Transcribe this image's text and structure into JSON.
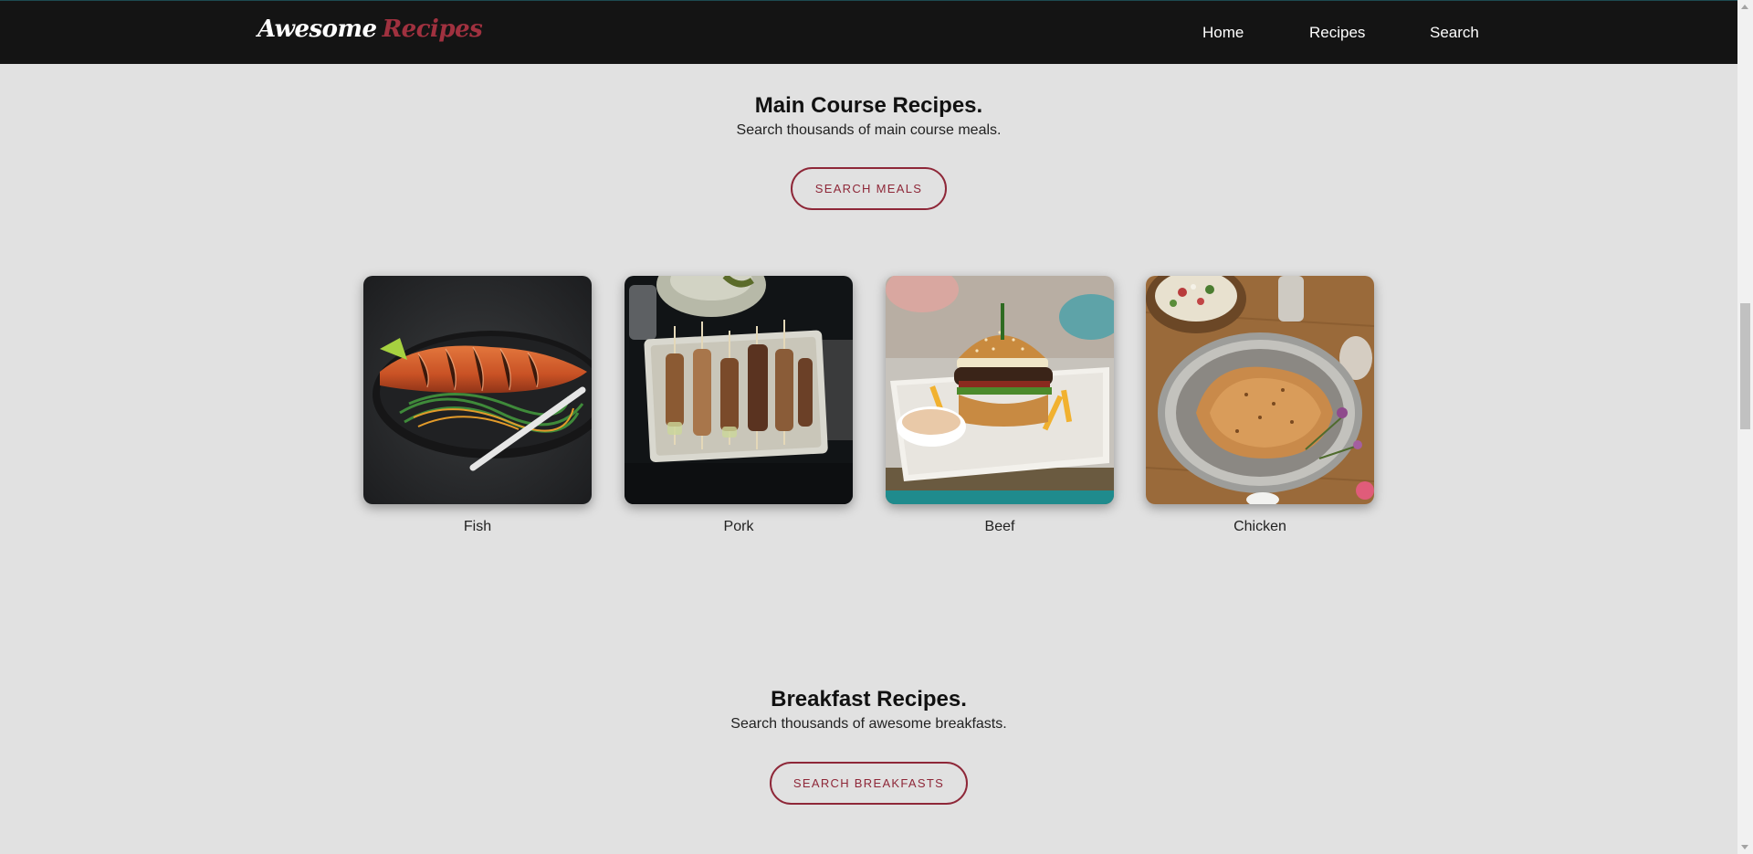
{
  "nav": {
    "brand_part1": "Awesome",
    "brand_part2": "Recipes",
    "links": [
      "Home",
      "Recipes",
      "Search"
    ]
  },
  "main_course": {
    "title": "Main Course Recipes.",
    "subtitle": "Search thousands of main course meals.",
    "button": "SEARCH MEALS",
    "cards": [
      {
        "label": "Fish",
        "icon": "salmon-plate-image"
      },
      {
        "label": "Pork",
        "icon": "pork-skewers-image"
      },
      {
        "label": "Beef",
        "icon": "burger-image"
      },
      {
        "label": "Chicken",
        "icon": "roast-chicken-image"
      }
    ]
  },
  "breakfast": {
    "title": "Breakfast Recipes.",
    "subtitle": "Search thousands of awesome breakfasts.",
    "button": "SEARCH BREAKFASTS"
  },
  "colors": {
    "accent": "#8e2738",
    "navbar": "#141414",
    "background": "#e1e1e1"
  }
}
